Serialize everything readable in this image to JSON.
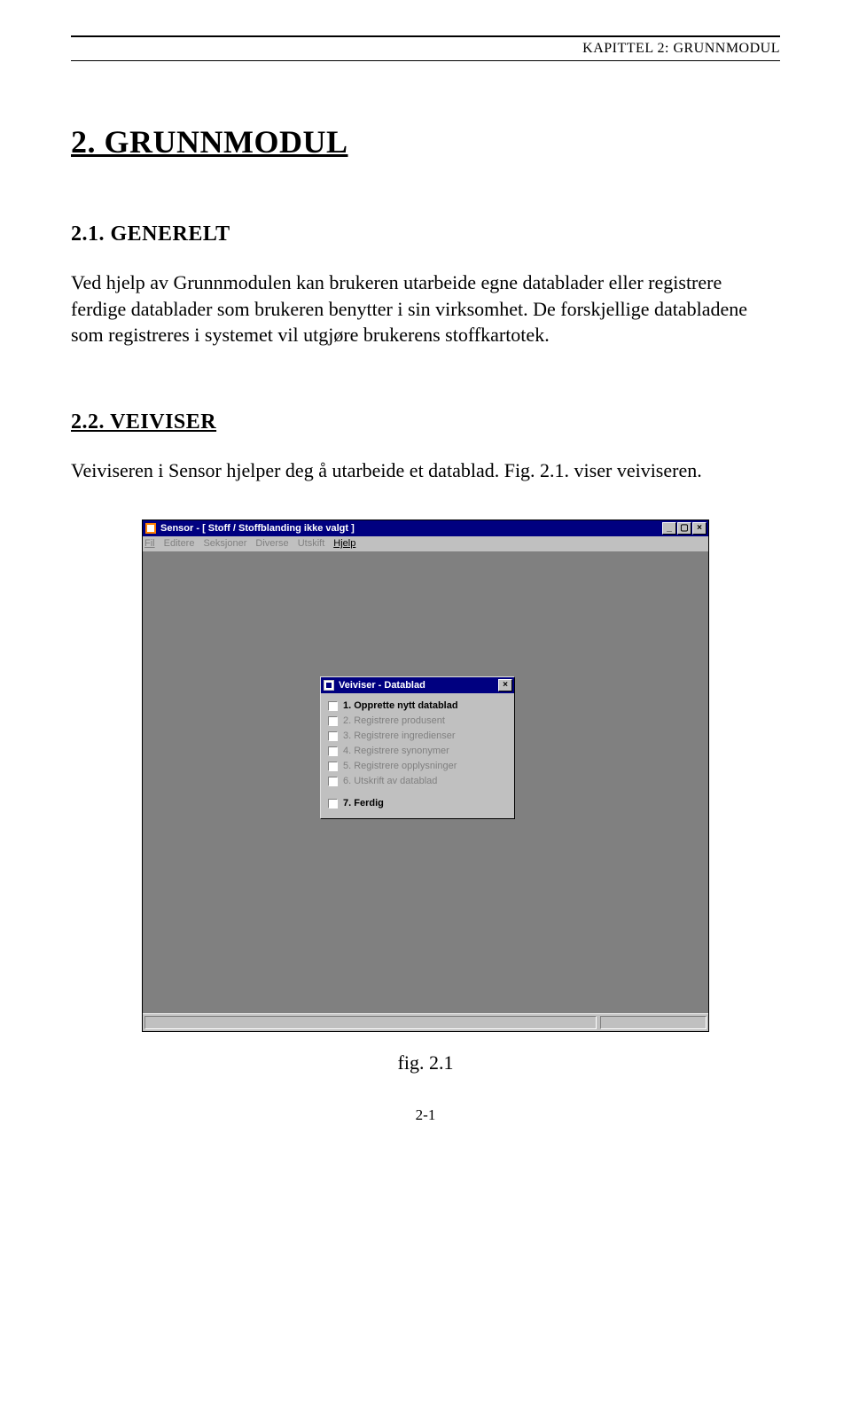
{
  "header": {
    "chapter_label": "KAPITTEL 2: GRUNNMODUL"
  },
  "h1": "2. GRUNNMODUL",
  "section_21": {
    "heading": "2.1. GENERELT",
    "paragraph": "Ved hjelp av Grunnmodulen kan brukeren utarbeide egne datablader eller registrere ferdige datablader som brukeren benytter i sin virksomhet. De forskjellige databladene som registreres i systemet vil utgjøre brukerens stoffkartotek."
  },
  "section_22": {
    "heading": "2.2. VEIVISER",
    "paragraph": "Veiviseren i Sensor hjelper deg å utarbeide et datablad. Fig. 2.1. viser veiviseren."
  },
  "screenshot": {
    "app_title": "Sensor - [ Stoff / Stoffblanding ikke valgt ]",
    "win_buttons": {
      "min": "_",
      "max": "▢",
      "close": "×"
    },
    "menu": {
      "items": [
        {
          "label": "Fil",
          "enabled": false
        },
        {
          "label": "Editere",
          "enabled": false
        },
        {
          "label": "Seksjoner",
          "enabled": false
        },
        {
          "label": "Diverse",
          "enabled": false
        },
        {
          "label": "Utskift",
          "enabled": false
        },
        {
          "label": "Hjelp",
          "enabled": true
        }
      ]
    },
    "wizard": {
      "title": "Veiviser - Datablad",
      "close": "×",
      "steps": [
        {
          "label": "1. Opprette nytt datablad",
          "state": "current"
        },
        {
          "label": "2. Registrere produsent",
          "state": "pending"
        },
        {
          "label": "3. Registrere ingredienser",
          "state": "pending"
        },
        {
          "label": "4. Registrere synonymer",
          "state": "pending"
        },
        {
          "label": "5. Registrere opplysninger",
          "state": "pending"
        },
        {
          "label": "6. Utskrift av datablad",
          "state": "pending"
        }
      ],
      "final_step": {
        "label": "7. Ferdig",
        "state": "current"
      }
    }
  },
  "figure_caption": "fig. 2.1",
  "page_number": "2-1"
}
